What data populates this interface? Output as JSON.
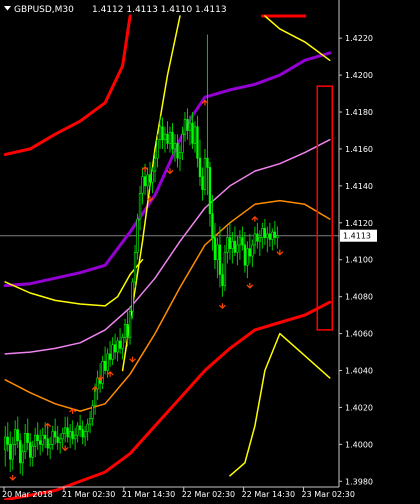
{
  "chart_data": {
    "type": "candlestick",
    "symbol": "GBPUSD,M30",
    "ohlc_header": "1.4112 1.4113 1.4110 1.4113",
    "current_price_label": "1.4113",
    "current_price": 1.4113,
    "ylim": [
      1.3978,
      1.4232
    ],
    "yticks": [
      "1.4220",
      "1.4200",
      "1.4180",
      "1.4160",
      "1.4140",
      "1.4120",
      "1.4100",
      "1.4080",
      "1.4060",
      "1.4040",
      "1.4020",
      "1.4000",
      "1.3980"
    ],
    "ytick_values": [
      1.422,
      1.42,
      1.418,
      1.416,
      1.414,
      1.412,
      1.41,
      1.408,
      1.406,
      1.404,
      1.402,
      1.4,
      1.398
    ],
    "xticks": [
      "20 Mar 2018",
      "21 Mar 02:30",
      "21 Mar 14:30",
      "22 Mar 02:30",
      "22 Mar 14:30",
      "23 Mar 02:30"
    ],
    "xtick_index": [
      0,
      24,
      48,
      72,
      96,
      120
    ],
    "num_bars": 133,
    "candles": [
      [
        1.3997,
        1.401,
        1.3988,
        1.4004
      ],
      [
        1.4004,
        1.4012,
        1.3996,
        1.4
      ],
      [
        1.4,
        1.4007,
        1.3985,
        1.3992
      ],
      [
        1.3992,
        1.4004,
        1.3986,
        1.4
      ],
      [
        1.4,
        1.4013,
        1.3994,
        1.4008
      ],
      [
        1.4008,
        1.4015,
        1.3998,
        1.4002
      ],
      [
        1.4002,
        1.4006,
        1.3984,
        1.399
      ],
      [
        1.399,
        1.4,
        1.3983,
        1.3996
      ],
      [
        1.3996,
        1.4011,
        1.3992,
        1.4006
      ],
      [
        1.4006,
        1.4014,
        1.3997,
        1.4001
      ],
      [
        1.4001,
        1.4006,
        1.3988,
        1.3993
      ],
      [
        1.3993,
        1.4002,
        1.3988,
        1.3999
      ],
      [
        1.3999,
        1.4009,
        1.3993,
        1.4005
      ],
      [
        1.4005,
        1.4012,
        1.3997,
        1.4002
      ],
      [
        1.4002,
        1.4008,
        1.3994,
        1.4
      ],
      [
        1.4,
        1.4009,
        1.3996,
        1.4005
      ],
      [
        1.4005,
        1.4012,
        1.3998,
        1.4003
      ],
      [
        1.4003,
        1.4009,
        1.3994,
        1.3998
      ],
      [
        1.3998,
        1.4004,
        1.3992,
        1.4
      ],
      [
        1.4,
        1.401,
        1.3997,
        1.4007
      ],
      [
        1.4007,
        1.4014,
        1.4,
        1.4004
      ],
      [
        1.4004,
        1.401,
        1.3997,
        1.4001
      ],
      [
        1.4001,
        1.4006,
        1.3995,
        1.4003
      ],
      [
        1.4003,
        1.4009,
        1.3998,
        1.4006
      ],
      [
        1.4006,
        1.4015,
        1.4001,
        1.4009
      ],
      [
        1.4009,
        1.4015,
        1.4001,
        1.4004
      ],
      [
        1.4004,
        1.4011,
        1.3998,
        1.4007
      ],
      [
        1.4007,
        1.4013,
        1.4,
        1.4003
      ],
      [
        1.4003,
        1.4009,
        1.3997,
        1.4005
      ],
      [
        1.4005,
        1.4012,
        1.4001,
        1.401
      ],
      [
        1.401,
        1.4016,
        1.4004,
        1.4008
      ],
      [
        1.4008,
        1.4013,
        1.4,
        1.4004
      ],
      [
        1.4004,
        1.401,
        1.3999,
        1.4007
      ],
      [
        1.4007,
        1.4014,
        1.4002,
        1.4011
      ],
      [
        1.4011,
        1.4018,
        1.4006,
        1.4014
      ],
      [
        1.4014,
        1.4024,
        1.401,
        1.4021
      ],
      [
        1.4021,
        1.4033,
        1.4016,
        1.403
      ],
      [
        1.403,
        1.404,
        1.4024,
        1.4036
      ],
      [
        1.4036,
        1.4044,
        1.4028,
        1.4033
      ],
      [
        1.4033,
        1.4048,
        1.403,
        1.4045
      ],
      [
        1.4045,
        1.4053,
        1.4038,
        1.404
      ],
      [
        1.404,
        1.4052,
        1.4036,
        1.4049
      ],
      [
        1.4049,
        1.4056,
        1.4042,
        1.4046
      ],
      [
        1.4046,
        1.4058,
        1.4043,
        1.4054
      ],
      [
        1.4054,
        1.406,
        1.4046,
        1.405
      ],
      [
        1.405,
        1.4058,
        1.4045,
        1.4056
      ],
      [
        1.4056,
        1.4063,
        1.4049,
        1.4052
      ],
      [
        1.4052,
        1.406,
        1.4046,
        1.4058
      ],
      [
        1.4058,
        1.4068,
        1.4055,
        1.4065
      ],
      [
        1.4065,
        1.4072,
        1.4053,
        1.4058
      ],
      [
        1.4058,
        1.4075,
        1.4054,
        1.4072
      ],
      [
        1.4072,
        1.409,
        1.4068,
        1.4088
      ],
      [
        1.4088,
        1.4108,
        1.4085,
        1.4104
      ],
      [
        1.4104,
        1.4125,
        1.41,
        1.4122
      ],
      [
        1.4122,
        1.414,
        1.4116,
        1.4136
      ],
      [
        1.4136,
        1.415,
        1.413,
        1.4145
      ],
      [
        1.4145,
        1.4152,
        1.4135,
        1.414
      ],
      [
        1.414,
        1.415,
        1.4133,
        1.4146
      ],
      [
        1.4146,
        1.4153,
        1.4138,
        1.4142
      ],
      [
        1.4142,
        1.415,
        1.4136,
        1.4148
      ],
      [
        1.4148,
        1.4158,
        1.4142,
        1.4155
      ],
      [
        1.4155,
        1.4168,
        1.415,
        1.4165
      ],
      [
        1.4165,
        1.4178,
        1.416,
        1.4172
      ],
      [
        1.4172,
        1.4177,
        1.416,
        1.4165
      ],
      [
        1.4165,
        1.4172,
        1.4158,
        1.4168
      ],
      [
        1.4168,
        1.4175,
        1.416,
        1.4163
      ],
      [
        1.4163,
        1.4172,
        1.4158,
        1.4169
      ],
      [
        1.4169,
        1.4174,
        1.4157,
        1.416
      ],
      [
        1.416,
        1.4168,
        1.4153,
        1.4163
      ],
      [
        1.4163,
        1.4168,
        1.415,
        1.4155
      ],
      [
        1.4155,
        1.4162,
        1.4148,
        1.4158
      ],
      [
        1.4158,
        1.4172,
        1.4154,
        1.4168
      ],
      [
        1.4168,
        1.418,
        1.4164,
        1.4176
      ],
      [
        1.4176,
        1.4182,
        1.4165,
        1.417
      ],
      [
        1.417,
        1.4178,
        1.4162,
        1.4174
      ],
      [
        1.4174,
        1.418,
        1.416,
        1.4163
      ],
      [
        1.4163,
        1.4175,
        1.4158,
        1.4172
      ],
      [
        1.4172,
        1.4178,
        1.415,
        1.4155
      ],
      [
        1.4155,
        1.4165,
        1.414,
        1.4145
      ],
      [
        1.4145,
        1.415,
        1.4132,
        1.4138
      ],
      [
        1.4138,
        1.416,
        1.4135,
        1.4155
      ],
      [
        1.4155,
        1.4222,
        1.4135,
        1.415
      ],
      [
        1.415,
        1.4153,
        1.4118,
        1.4125
      ],
      [
        1.4125,
        1.4135,
        1.4105,
        1.4112
      ],
      [
        1.4112,
        1.412,
        1.4095,
        1.41
      ],
      [
        1.41,
        1.4112,
        1.409,
        1.4108
      ],
      [
        1.4108,
        1.4118,
        1.4085,
        1.4092
      ],
      [
        1.4092,
        1.4098,
        1.408,
        1.4086
      ],
      [
        1.4086,
        1.4108,
        1.4083,
        1.4104
      ],
      [
        1.4104,
        1.4118,
        1.4098,
        1.4112
      ],
      [
        1.4112,
        1.412,
        1.41,
        1.4106
      ],
      [
        1.4106,
        1.4115,
        1.4098,
        1.411
      ],
      [
        1.411,
        1.4118,
        1.4102,
        1.4104
      ],
      [
        1.4104,
        1.4113,
        1.4097,
        1.4108
      ],
      [
        1.4108,
        1.4116,
        1.41,
        1.4112
      ],
      [
        1.4112,
        1.4118,
        1.4105,
        1.4108
      ],
      [
        1.4108,
        1.4115,
        1.4093,
        1.4097
      ],
      [
        1.4097,
        1.411,
        1.409,
        1.4106
      ],
      [
        1.4106,
        1.4114,
        1.4098,
        1.4102
      ],
      [
        1.4102,
        1.4111,
        1.4096,
        1.4108
      ],
      [
        1.4108,
        1.4118,
        1.4103,
        1.4114
      ],
      [
        1.4114,
        1.412,
        1.4106,
        1.411
      ],
      [
        1.411,
        1.4116,
        1.4102,
        1.4112
      ],
      [
        1.4112,
        1.412,
        1.4106,
        1.4117
      ],
      [
        1.4117,
        1.4122,
        1.4108,
        1.4112
      ],
      [
        1.4112,
        1.4118,
        1.4104,
        1.4114
      ],
      [
        1.4114,
        1.412,
        1.4107,
        1.4111
      ],
      [
        1.4111,
        1.4117,
        1.4105,
        1.4115
      ],
      [
        1.4115,
        1.4121,
        1.4108,
        1.4112
      ],
      [
        1.4112,
        1.4118,
        1.4106,
        1.4113
      ]
    ],
    "lines": [
      {
        "role": "upper-outer",
        "color": "#ff0000",
        "width": 3,
        "points": [
          [
            0,
            1.4157
          ],
          [
            10,
            1.416
          ],
          [
            20,
            1.4168
          ],
          [
            30,
            1.4175
          ],
          [
            40,
            1.4185
          ],
          [
            47,
            1.4205
          ],
          [
            50,
            1.4232
          ]
        ]
      },
      {
        "role": "upper-outer-2",
        "color": "#ff0000",
        "width": 3,
        "points": [
          [
            103,
            1.4232
          ],
          [
            120,
            1.4232
          ]
        ]
      },
      {
        "role": "trend",
        "color": "#9400d3",
        "width": 3,
        "points": [
          [
            0,
            1.4086
          ],
          [
            10,
            1.4087
          ],
          [
            20,
            1.409
          ],
          [
            30,
            1.4093
          ],
          [
            40,
            1.4097
          ],
          [
            50,
            1.4115
          ],
          [
            60,
            1.4135
          ],
          [
            70,
            1.4165
          ],
          [
            75,
            1.4178
          ],
          [
            80,
            1.4188
          ],
          [
            90,
            1.4192
          ],
          [
            100,
            1.4195
          ],
          [
            110,
            1.42
          ],
          [
            120,
            1.4208
          ],
          [
            130,
            1.4212
          ]
        ]
      },
      {
        "role": "mid-upper",
        "color": "#ee82ee",
        "width": 1.5,
        "points": [
          [
            0,
            1.4049
          ],
          [
            10,
            1.405
          ],
          [
            20,
            1.4052
          ],
          [
            30,
            1.4055
          ],
          [
            40,
            1.4062
          ],
          [
            50,
            1.4074
          ],
          [
            60,
            1.409
          ],
          [
            70,
            1.411
          ],
          [
            80,
            1.4128
          ],
          [
            90,
            1.414
          ],
          [
            100,
            1.4148
          ],
          [
            110,
            1.4152
          ],
          [
            120,
            1.4158
          ],
          [
            130,
            1.4165
          ]
        ]
      },
      {
        "role": "mid",
        "color": "#ff8c00",
        "width": 1.5,
        "points": [
          [
            0,
            1.4035
          ],
          [
            10,
            1.4028
          ],
          [
            20,
            1.4022
          ],
          [
            30,
            1.4018
          ],
          [
            40,
            1.4022
          ],
          [
            50,
            1.4038
          ],
          [
            60,
            1.406
          ],
          [
            70,
            1.4085
          ],
          [
            80,
            1.4108
          ],
          [
            90,
            1.412
          ],
          [
            100,
            1.413
          ],
          [
            110,
            1.4132
          ],
          [
            120,
            1.413
          ],
          [
            130,
            1.4122
          ]
        ]
      },
      {
        "role": "lower-outer",
        "color": "#ff0000",
        "width": 3,
        "points": [
          [
            0,
            1.397
          ],
          [
            20,
            1.3975
          ],
          [
            40,
            1.3985
          ],
          [
            50,
            1.3995
          ],
          [
            60,
            1.401
          ],
          [
            70,
            1.4025
          ],
          [
            80,
            1.404
          ],
          [
            90,
            1.4052
          ],
          [
            100,
            1.4062
          ],
          [
            110,
            1.4066
          ],
          [
            120,
            1.407
          ],
          [
            130,
            1.4077
          ]
        ]
      },
      {
        "role": "band-upper",
        "color": "#ffff00",
        "width": 1.5,
        "points": [
          [
            47,
            1.404
          ],
          [
            55,
            1.411
          ],
          [
            60,
            1.416
          ],
          [
            65,
            1.42
          ],
          [
            70,
            1.4232
          ]
        ]
      },
      {
        "role": "band-lower",
        "color": "#ffff00",
        "width": 1.5,
        "points": [
          [
            0,
            1.4088
          ],
          [
            10,
            1.4082
          ],
          [
            20,
            1.4078
          ],
          [
            30,
            1.4076
          ],
          [
            40,
            1.4075
          ],
          [
            45,
            1.408
          ],
          [
            50,
            1.4092
          ],
          [
            55,
            1.41
          ]
        ]
      },
      {
        "role": "band-upper-2",
        "color": "#ffff00",
        "width": 1.5,
        "points": [
          [
            104,
            1.4232
          ],
          [
            110,
            1.4225
          ],
          [
            120,
            1.4218
          ],
          [
            130,
            1.4208
          ]
        ]
      },
      {
        "role": "band-lower-2",
        "color": "#ffff00",
        "width": 1.5,
        "points": [
          [
            90,
            1.3983
          ],
          [
            96,
            1.399
          ],
          [
            100,
            1.401
          ],
          [
            104,
            1.404
          ],
          [
            110,
            1.406
          ],
          [
            120,
            1.4048
          ],
          [
            130,
            1.4036
          ]
        ]
      }
    ],
    "arrows_up": [
      [
        17,
        1.4008
      ],
      [
        27,
        1.4016
      ],
      [
        36,
        1.4028
      ],
      [
        42,
        1.4036
      ],
      [
        56,
        1.4147
      ],
      [
        80,
        1.4183
      ],
      [
        100,
        1.412
      ]
    ],
    "arrows_down": [
      [
        3,
        1.3984
      ],
      [
        24,
        1.4
      ],
      [
        38,
        1.4038
      ],
      [
        51,
        1.4048
      ],
      [
        58,
        1.4135
      ],
      [
        66,
        1.415
      ],
      [
        87,
        1.4077
      ],
      [
        98,
        1.4088
      ],
      [
        110,
        1.4106
      ]
    ],
    "annotation_box": {
      "x_from": 125,
      "x_to": 131,
      "y_top": 1.4194,
      "y_bottom": 1.4062,
      "color": "#ff0000"
    }
  }
}
